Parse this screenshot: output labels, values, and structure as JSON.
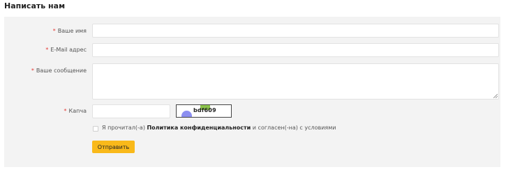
{
  "form": {
    "title": "Написать нам",
    "required_mark": "*",
    "fields": {
      "name": {
        "label": "Ваше имя",
        "value": ""
      },
      "email": {
        "label": "E-Mail адрес",
        "value": ""
      },
      "message": {
        "label": "Ваше сообщение",
        "value": ""
      },
      "captcha": {
        "label": "Капча",
        "value": "",
        "image_text": "bdf609"
      }
    },
    "consent": {
      "text_before": "Я прочитал(-а) ",
      "policy_link": "Политика конфиденциальности",
      "text_after": " и согласен(-на) с условиями",
      "checked": false
    },
    "submit_label": "Отправить"
  },
  "colors": {
    "panel_background": "#f3f3f3",
    "required_mark": "#e53935",
    "submit_button": "#f9b91a"
  }
}
